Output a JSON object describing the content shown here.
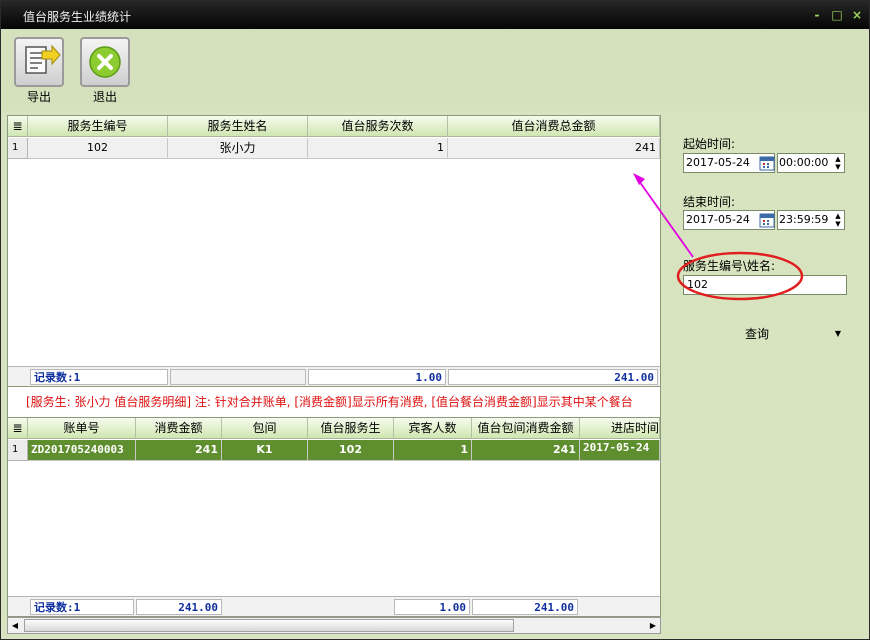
{
  "window": {
    "title": "值台服务生业绩统计",
    "controls": [
      "-",
      "□",
      "×"
    ]
  },
  "toolbar": {
    "export_label": "导出",
    "exit_label": "退出"
  },
  "top_grid": {
    "headers": [
      "服务生编号",
      "服务生姓名",
      "值台服务次数",
      "值台消费总金额"
    ],
    "rows": [
      {
        "num": "1",
        "cells": [
          "102",
          "张小力",
          "1",
          "241"
        ]
      }
    ],
    "footer": {
      "count_label": "记录数:1",
      "service_total": "1.00",
      "amount_total": "241.00"
    }
  },
  "info_text": "[服务生: 张小力 值台服务明细]   注: 针对合并账单, [消费金额]显示所有消费, [值台餐台消费金额]显示其中某个餐台",
  "bottom_grid": {
    "headers": [
      "账单号",
      "消费金额",
      "包间",
      "值台服务生",
      "宾客人数",
      "值台包间消费金额",
      "进店时间"
    ],
    "rows": [
      {
        "num": "1",
        "cells": [
          "ZD201705240003",
          "241",
          "K1",
          "102",
          "1",
          "241",
          "2017-05-24"
        ]
      }
    ],
    "footer": {
      "count_label": "记录数:1",
      "amount_total": "241.00",
      "guests_total": "1.00",
      "room_total": "241.00"
    }
  },
  "filters": {
    "start_label": "起始时间:",
    "start_date": "2017-05-24",
    "start_time": "00:00:00",
    "end_label": "结束时间:",
    "end_date": "2017-05-24",
    "end_time": "23:59:59",
    "staff_label": "服务生编号\\姓名:",
    "staff_value": "102",
    "query_label": "查询"
  },
  "colors": {
    "selected_row": "#5e8e2e",
    "footer_text": "#1030a0",
    "info_text": "#e01010",
    "annotation": "#e000e0",
    "highlight_ring": "#e02020"
  }
}
